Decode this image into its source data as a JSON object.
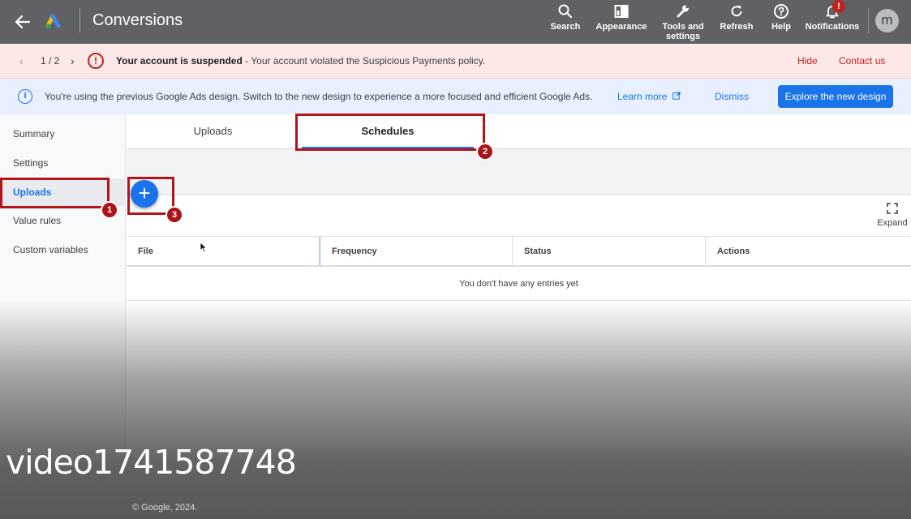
{
  "header": {
    "title": "Conversions",
    "tools": [
      {
        "label": "Search",
        "icon": "search-icon"
      },
      {
        "label": "Appearance",
        "icon": "appearance-icon"
      },
      {
        "label": "Tools and settings",
        "icon": "wrench-icon"
      },
      {
        "label": "Refresh",
        "icon": "refresh-icon"
      },
      {
        "label": "Help",
        "icon": "help-icon"
      },
      {
        "label": "Notifications",
        "icon": "bell-icon"
      }
    ],
    "notification_badge": "!",
    "avatar_initial": "m"
  },
  "alert": {
    "prev": "‹",
    "counter": "1 / 2",
    "next": "›",
    "icon_glyph": "!",
    "bold_text": "Your account is suspended",
    "text": " - Your account violated the Suspicious Payments policy.",
    "hide": "Hide",
    "contact": "Contact us",
    "color": "#c5221f"
  },
  "info": {
    "icon_glyph": "i",
    "text": "You're using the previous Google Ads design. Switch to the new design to experience a more focused and efficient Google Ads.",
    "learn_more": "Learn more",
    "dismiss": "Dismiss",
    "explore": "Explore the new design",
    "accent": "#1a73e8"
  },
  "sidebar": {
    "items": [
      {
        "label": "Summary",
        "active": false
      },
      {
        "label": "Settings",
        "active": false
      },
      {
        "label": "Uploads",
        "active": true
      },
      {
        "label": "Value rules",
        "active": false
      },
      {
        "label": "Custom variables",
        "active": false
      }
    ]
  },
  "tabs": [
    "Uploads",
    "Schedules"
  ],
  "active_tab": "Schedules",
  "add_button": "+",
  "expand_label": "Expand",
  "table": {
    "columns": [
      "File",
      "Frequency",
      "Status",
      "Actions"
    ],
    "empty_message": "You don't have any entries yet"
  },
  "markers": [
    "1",
    "2",
    "3"
  ],
  "footer": "© Google, 2024.",
  "watermark": "video1741587748"
}
